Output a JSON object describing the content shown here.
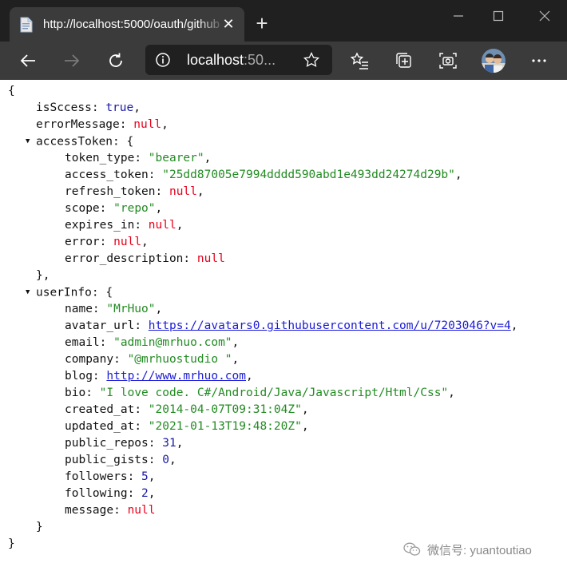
{
  "browser": {
    "tab_title": "http://localhost:5000/oauth/github",
    "tab_close": "✕",
    "new_tab": "+",
    "address_host": "localhost",
    "address_rest": ":50..."
  },
  "json": {
    "open_brace": "{",
    "close_brace": "}",
    "lines": {
      "isSccess": {
        "key": "isSccess",
        "value": "true"
      },
      "errorMessage": {
        "key": "errorMessage",
        "value": "null"
      },
      "accessToken": {
        "key": "accessToken",
        "open": "{",
        "close": "},"
      },
      "token_type": {
        "key": "token_type",
        "value": "\"bearer\""
      },
      "access_token": {
        "key": "access_token",
        "value": "\"25dd87005e7994dddd590abd1e493dd24274d29b\""
      },
      "refresh_token": {
        "key": "refresh_token",
        "value": "null"
      },
      "scope": {
        "key": "scope",
        "value": "\"repo\""
      },
      "expires_in": {
        "key": "expires_in",
        "value": "null"
      },
      "error": {
        "key": "error",
        "value": "null"
      },
      "error_description": {
        "key": "error_description",
        "value": "null"
      },
      "userInfo": {
        "key": "userInfo",
        "open": "{",
        "close": "}"
      },
      "name": {
        "key": "name",
        "value": "\"MrHuo\""
      },
      "avatar_url": {
        "key": "avatar_url",
        "value": "https://avatars0.githubusercontent.com/u/7203046?v=4"
      },
      "email": {
        "key": "email",
        "value": "\"admin@mrhuo.com\""
      },
      "company": {
        "key": "company",
        "value": "\"@mrhuostudio \""
      },
      "blog": {
        "key": "blog",
        "value": "http://www.mrhuo.com"
      },
      "bio": {
        "key": "bio",
        "value": "\"I love code. C#/Android/Java/Javascript/Html/Css\""
      },
      "created_at": {
        "key": "created_at",
        "value": "\"2014-04-07T09:31:04Z\""
      },
      "updated_at": {
        "key": "updated_at",
        "value": "\"2021-01-13T19:48:20Z\""
      },
      "public_repos": {
        "key": "public_repos",
        "value": "31"
      },
      "public_gists": {
        "key": "public_gists",
        "value": "0"
      },
      "followers": {
        "key": "followers",
        "value": "5"
      },
      "following": {
        "key": "following",
        "value": "2"
      },
      "message": {
        "key": "message",
        "value": "null"
      }
    }
  },
  "watermark": {
    "text": "微信号: yuantoutiao"
  },
  "colors": {
    "string": "#228b22",
    "number": "#1a1aa6",
    "null": "#e8001c",
    "link": "#1b1bd8",
    "chrome_dark": "#202020",
    "chrome_mid": "#3b3b3b"
  }
}
